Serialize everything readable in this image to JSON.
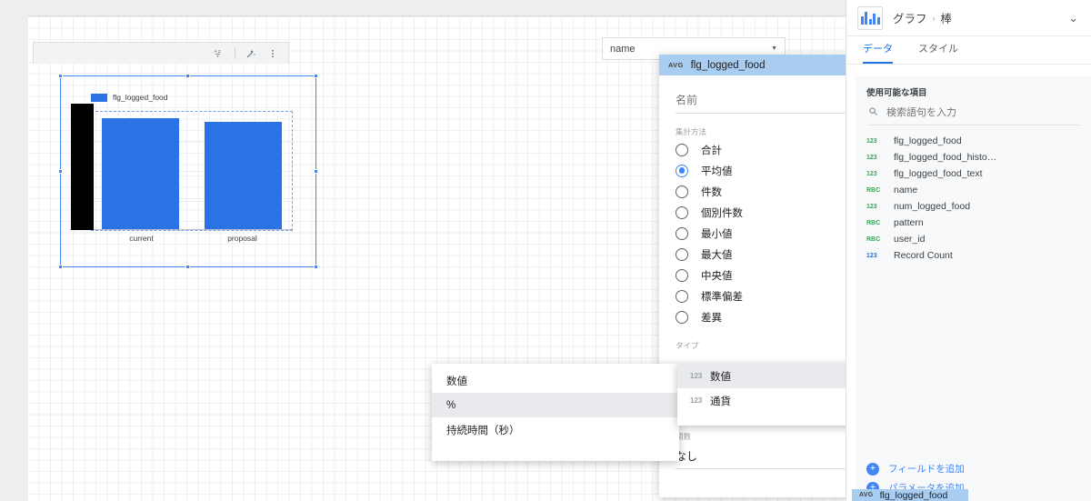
{
  "canvas": {
    "chart": {
      "toolbar_icons": [
        "sort-az-icon",
        "magic-wand-icon",
        "more-vert-icon"
      ],
      "legend_label": "flg_logged_food",
      "categories": [
        "current",
        "proposal"
      ],
      "bar_color": "#2a72e5"
    },
    "name_chip": {
      "label": "name",
      "caret": "▼"
    }
  },
  "chart_data": {
    "type": "bar",
    "title": "",
    "categories": [
      "current",
      "proposal"
    ],
    "series": [
      {
        "name": "flg_logged_food",
        "values": [
          0.93,
          0.9
        ]
      }
    ],
    "values": [
      0.93,
      0.9
    ],
    "xlabel": "",
    "ylabel": "",
    "ylim": [
      0,
      1
    ],
    "grid": true,
    "legend_position": "top-left",
    "legend": [
      "flg_logged_food"
    ],
    "note": "Y axis tick labels are obscured by a black redaction rectangle"
  },
  "field_dialog": {
    "badge": "AVG",
    "title": "flg_logged_food",
    "name_placeholder": "名前",
    "name_value": "",
    "aggregation_label": "集計方法",
    "aggregation_options": [
      {
        "label": "合計",
        "selected": false
      },
      {
        "label": "平均値",
        "selected": true
      },
      {
        "label": "件数",
        "selected": false
      },
      {
        "label": "個別件数",
        "selected": false
      },
      {
        "label": "最小値",
        "selected": false
      },
      {
        "label": "最大値",
        "selected": false
      },
      {
        "label": "中央値",
        "selected": false
      },
      {
        "label": "標準偏差",
        "selected": false
      },
      {
        "label": "差異",
        "selected": false
      }
    ],
    "type_label": "タイプ",
    "type_value": "",
    "format_value": "",
    "function_label": "関数",
    "function_value": "なし",
    "help_icon": "?"
  },
  "menu_format": {
    "items": [
      {
        "label": "数値",
        "highlighted": false
      },
      {
        "label": "%",
        "highlighted": true
      },
      {
        "label": "持続時間（秒）",
        "highlighted": false
      }
    ]
  },
  "menu_type": {
    "items": [
      {
        "type_badge": "123",
        "label": "数値",
        "arrow": "▸",
        "highlighted": true
      },
      {
        "type_badge": "123",
        "label": "通貨",
        "arrow": "▸",
        "highlighted": false
      }
    ]
  },
  "right_panel": {
    "breadcrumb": {
      "root": "グラフ",
      "sep": "›",
      "leaf": "棒"
    },
    "chart_icon": "bar-chart-icon",
    "collapse_icon": "⌄",
    "tabs": [
      {
        "label": "データ",
        "active": true
      },
      {
        "label": "スタイル",
        "active": false
      }
    ],
    "available": {
      "title": "使用可能な項目",
      "search_placeholder": "検索語句を入力",
      "search_value": "",
      "fields": [
        {
          "type": "123",
          "name": "flg_logged_food",
          "kind": "number"
        },
        {
          "type": "123",
          "name": "flg_logged_food_histo…",
          "kind": "number"
        },
        {
          "type": "123",
          "name": "flg_logged_food_text",
          "kind": "number"
        },
        {
          "type": "RBC",
          "name": "name",
          "kind": "text"
        },
        {
          "type": "123",
          "name": "num_logged_food",
          "kind": "number"
        },
        {
          "type": "RBC",
          "name": "pattern",
          "kind": "text"
        },
        {
          "type": "RBC",
          "name": "user_id",
          "kind": "text"
        },
        {
          "type": "123",
          "name": "Record Count",
          "kind": "record"
        }
      ]
    },
    "footer_actions": [
      {
        "label": "フィールドを追加",
        "icon": "plus-circle-icon"
      },
      {
        "label": "パラメータを追加",
        "icon": "plus-circle-icon"
      }
    ]
  },
  "partial_chip": {
    "badge": "AVG",
    "title": "flg_logged_food"
  }
}
